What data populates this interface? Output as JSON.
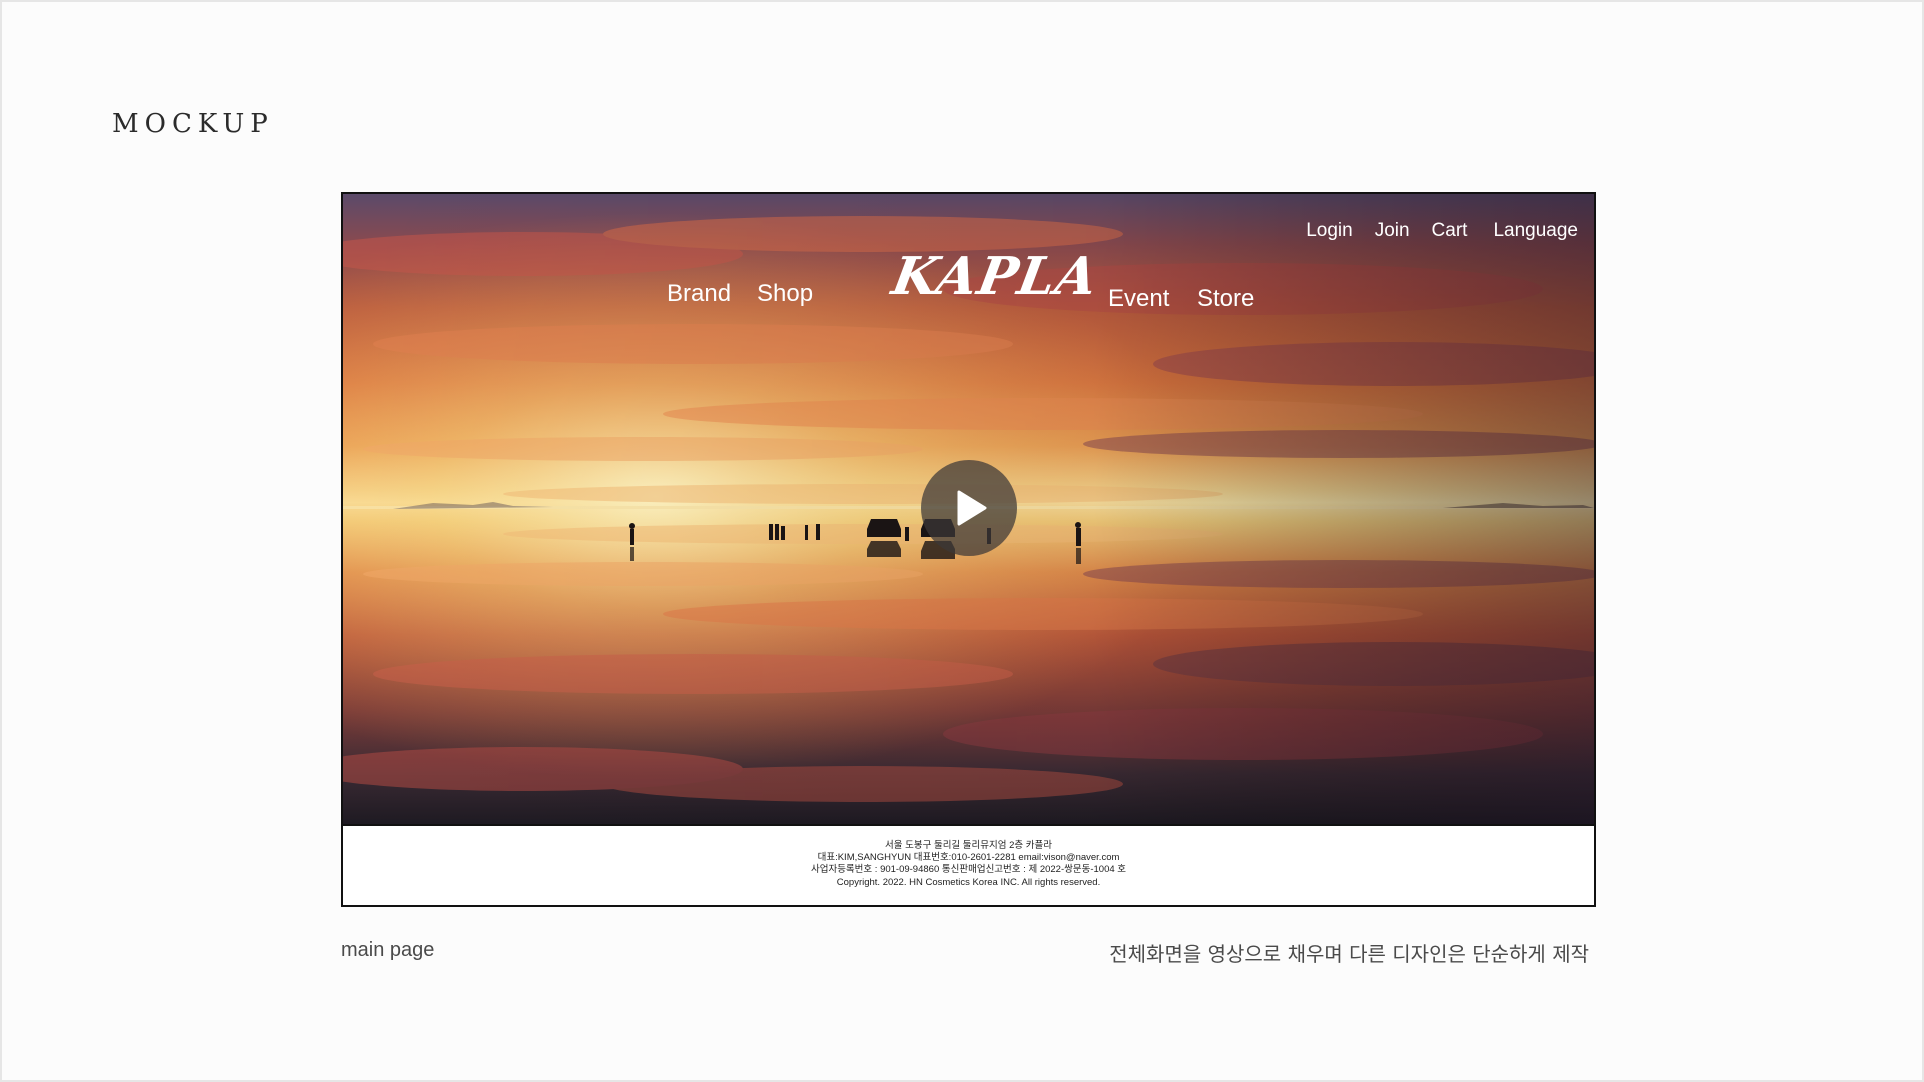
{
  "page": {
    "title": "MOCKUP"
  },
  "site": {
    "top_links": [
      "Login",
      "Join",
      "Cart",
      "Language"
    ],
    "nav_left": [
      "Brand",
      "Shop"
    ],
    "logo": "KAPLA",
    "nav_right": [
      "Event",
      "Store"
    ],
    "play_icon": "play-icon"
  },
  "footer": {
    "lines": [
      "서울 도봉구 둘리길 둘리뮤지엄 2층 카플라",
      "대표:KIM,SANGHYUN  대표번호:010-2601-2281 email:vison@naver.com",
      "사업자등록번호 : 901-09-94860  통신판매업신고번호 : 제 2022-쌍문동-1004 호",
      "Copyright. 2022. HN Cosmetics Korea INC. All rights reserved."
    ]
  },
  "captions": {
    "left": "main page",
    "right": "전체화면을 영상으로 채우며 다른 디자인은 단순하게 제작"
  }
}
